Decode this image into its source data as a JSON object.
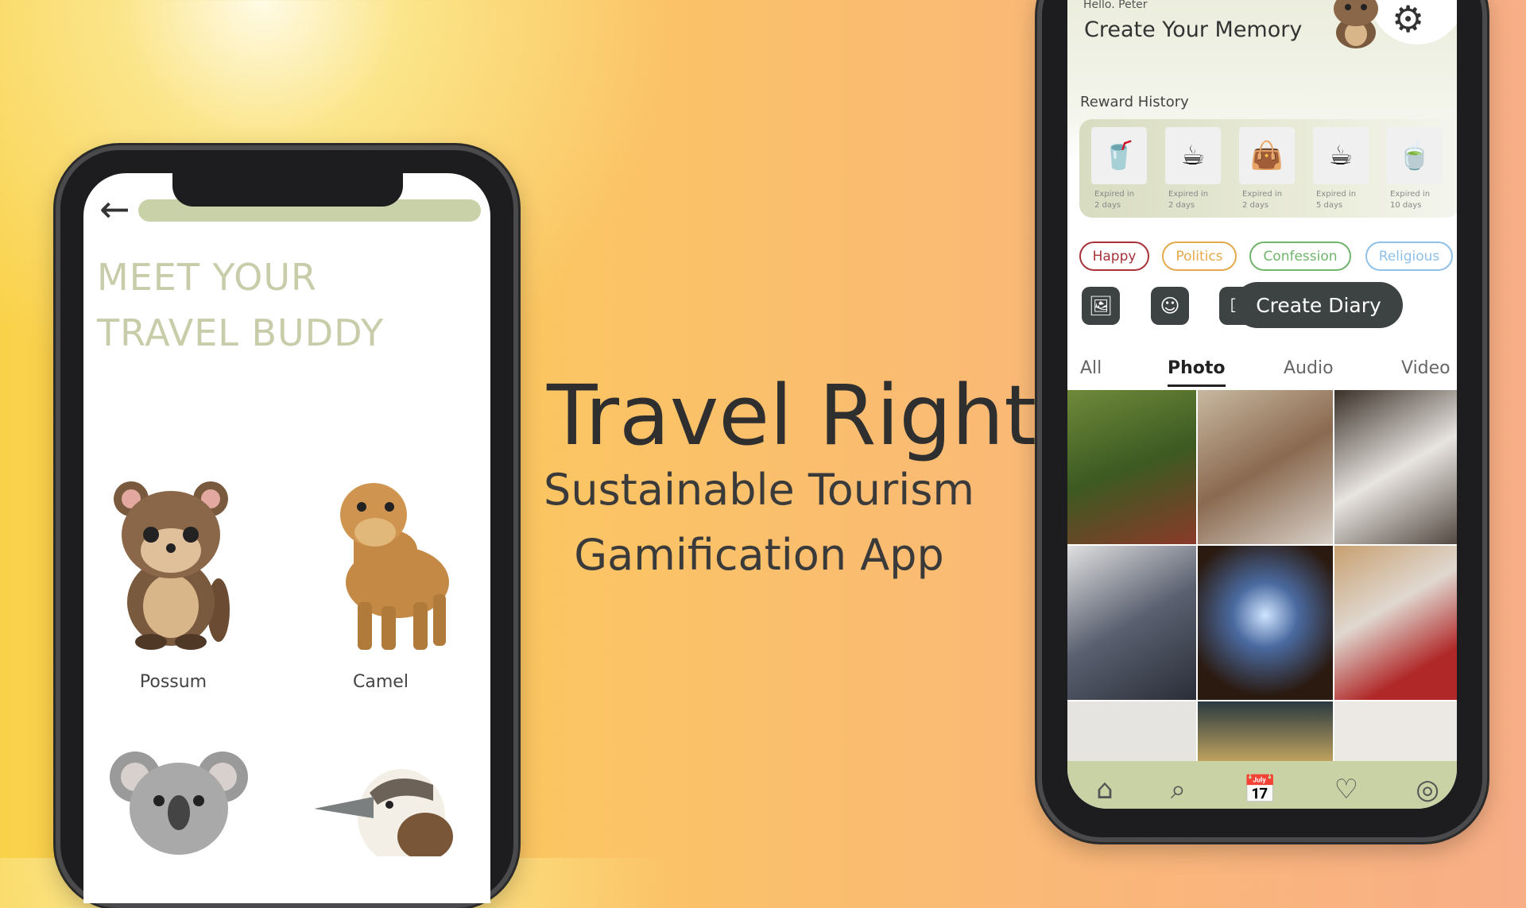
{
  "headline": {
    "title": "Travel Right",
    "subtitle_line1": "Sustainable Tourism",
    "subtitle_line2": "Gamification App"
  },
  "left_phone": {
    "back_icon": "arrow-left-icon",
    "heading_line1": "MEET YOUR",
    "heading_line2": "TRAVEL BUDDY",
    "progress": 0.0,
    "buddies": [
      {
        "label": "Possum"
      },
      {
        "label": "Camel"
      },
      {
        "label": ""
      },
      {
        "label": ""
      }
    ]
  },
  "right_phone": {
    "greeting": "Hello. Peter",
    "title": "Create Your Memory",
    "settings_icon": "gear-icon",
    "reward_history": {
      "label": "Reward History",
      "items": [
        {
          "icon": "iced-coffee",
          "expiry_line1": "Expired in",
          "expiry_line2": "2 days"
        },
        {
          "icon": "latte",
          "expiry_line1": "Expired in",
          "expiry_line2": "2 days"
        },
        {
          "icon": "tote-bag",
          "expiry_line1": "Expired in",
          "expiry_line2": "2 days"
        },
        {
          "icon": "latte",
          "expiry_line1": "Expired in",
          "expiry_line2": "5 days"
        },
        {
          "icon": "tea",
          "expiry_line1": "Expired in",
          "expiry_line2": "10 days"
        }
      ]
    },
    "tags": [
      {
        "label": "Happy",
        "color": "#a8323a"
      },
      {
        "label": "Politics",
        "color": "#e3a94a"
      },
      {
        "label": "Confession",
        "color": "#6fb56a"
      },
      {
        "label": "Religious",
        "color": "#8fc0e8"
      }
    ],
    "actions": {
      "add_photo_icon": "image-plus-icon",
      "mood_icon": "smile-icon",
      "checklist_icon": "checklist-icon",
      "create_label": "Create Diary"
    },
    "tabs": [
      {
        "label": "All"
      },
      {
        "label": "Photo",
        "active": true
      },
      {
        "label": "Audio"
      },
      {
        "label": "Video"
      }
    ],
    "nav": [
      "home-icon",
      "search-icon",
      "calendar-icon",
      "heart-icon",
      "profile-icon"
    ]
  }
}
